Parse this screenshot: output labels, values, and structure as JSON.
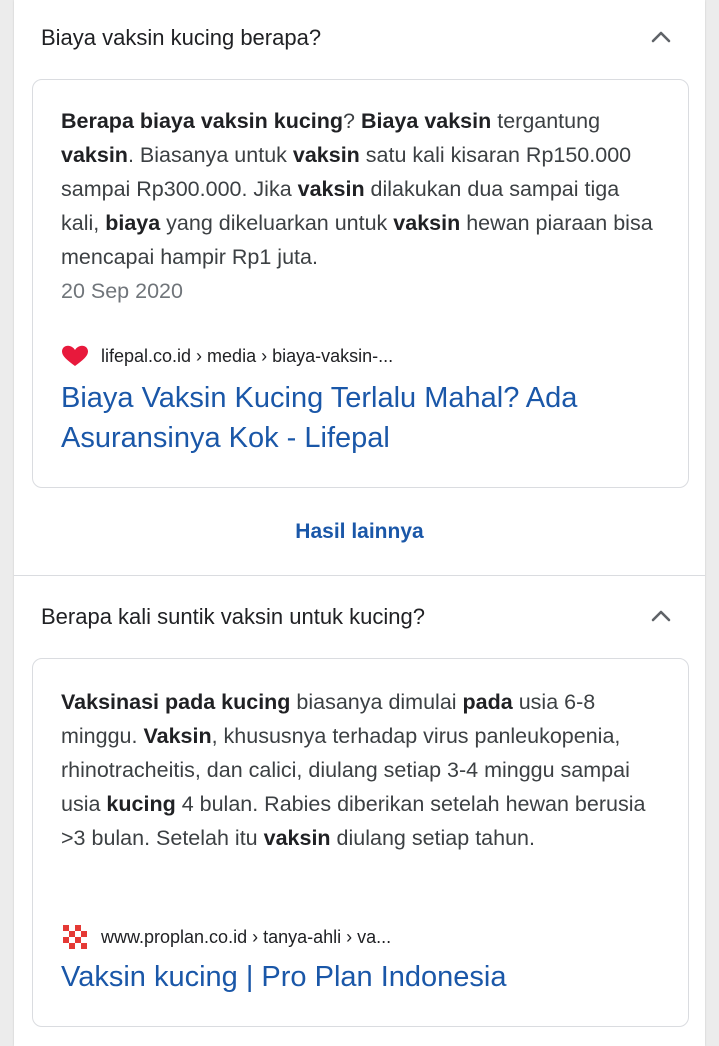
{
  "faq": [
    {
      "question": "Biaya vaksin kucing berapa?",
      "answer_parts": [
        {
          "text": "Berapa biaya vaksin kucing",
          "bold": true
        },
        {
          "text": "? ",
          "bold": false
        },
        {
          "text": "Biaya vaksin",
          "bold": true
        },
        {
          "text": " tergantung ",
          "bold": false
        },
        {
          "text": "vaksin",
          "bold": true
        },
        {
          "text": ". Biasanya untuk ",
          "bold": false
        },
        {
          "text": "vaksin",
          "bold": true
        },
        {
          "text": " satu kali kisaran Rp150.000 sampai Rp300.000. Jika ",
          "bold": false
        },
        {
          "text": "vaksin",
          "bold": true
        },
        {
          "text": " dilakukan dua sampai tiga kali, ",
          "bold": false
        },
        {
          "text": "biaya",
          "bold": true
        },
        {
          "text": " yang dikeluarkan untuk ",
          "bold": false
        },
        {
          "text": "vaksin",
          "bold": true
        },
        {
          "text": " hewan piaraan bisa mencapai hampir Rp1 juta.",
          "bold": false
        }
      ],
      "date": "20 Sep 2020",
      "source_breadcrumb": "lifepal.co.id › media › biaya-vaksin-...",
      "source_icon": "heart-icon",
      "source_icon_color": "#e8193c",
      "result_title": "Biaya Vaksin Kucing Terlalu Mahal? Ada Asuransinya Kok - Lifepal"
    },
    {
      "question": "Berapa kali suntik vaksin untuk kucing?",
      "answer_parts": [
        {
          "text": "Vaksinasi pada kucing",
          "bold": true
        },
        {
          "text": " biasanya dimulai ",
          "bold": false
        },
        {
          "text": "pada",
          "bold": true
        },
        {
          "text": " usia 6-8 minggu. ",
          "bold": false
        },
        {
          "text": "Vaksin",
          "bold": true
        },
        {
          "text": ", khususnya terhadap virus panleukopenia, rhinotracheitis, dan calici, diulang setiap 3-4 minggu sampai usia ",
          "bold": false
        },
        {
          "text": "kucing",
          "bold": true
        },
        {
          "text": " 4 bulan. Rabies diberikan setelah hewan berusia >3 bulan. Setelah itu ",
          "bold": false
        },
        {
          "text": "vaksin",
          "bold": true
        },
        {
          "text": " diulang setiap tahun.",
          "bold": false
        }
      ],
      "source_breadcrumb": "www.proplan.co.id › tanya-ahli › va...",
      "source_icon": "checkered-logo-icon",
      "source_icon_color": "#e53935",
      "result_title": "Vaksin kucing | Pro Plan Indonesia"
    }
  ],
  "more_results_label": "Hasil lainnya",
  "colors": {
    "link": "#1a57a8",
    "text": "#3c4043",
    "muted": "#70757a",
    "border": "#dadce0"
  }
}
